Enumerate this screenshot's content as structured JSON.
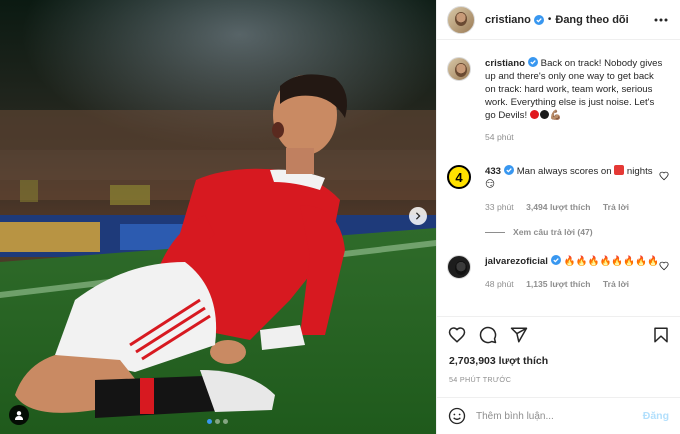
{
  "post": {
    "username": "cristiano",
    "follow_label": "Đang theo dõi",
    "dot": "•",
    "caption": {
      "username": "cristiano",
      "text": "Back on track! Nobody gives up and there's only one way to get back on track: hard work, team work, serious work. Everything else is just noise. Let's go Devils! ",
      "time": "54 phút"
    },
    "comments": [
      {
        "username": "433",
        "text": "Man always scores on ",
        "text_end": " nights ",
        "time": "33 phút",
        "likes": "3,494 lượt thích",
        "reply": "Trả lời",
        "view_replies": "Xem câu trả lời (47)"
      },
      {
        "username": "jalvarezoficial",
        "text": "🔥🔥🔥🔥🔥🔥🔥🔥",
        "time": "48 phút",
        "likes": "1,135 lượt thích",
        "reply": "Trả lời"
      }
    ],
    "likes_count": "2,703,903 lượt thích",
    "posted_time": "54 PHÚT TRƯỚC",
    "comment_placeholder": "Thêm bình luận...",
    "post_label": "Đăng",
    "carousel": {
      "slides": 3,
      "active": 1
    }
  },
  "colors": {
    "verified": "#3897f0",
    "post_disabled": "#b2dffc",
    "muted": "#8e8e8e",
    "text": "#262626"
  },
  "icons": [
    "verified-icon",
    "more-options-icon",
    "heart-icon",
    "comment-icon",
    "share-icon",
    "save-icon",
    "emoji-icon",
    "chevron-right-icon",
    "user-tag-icon"
  ]
}
